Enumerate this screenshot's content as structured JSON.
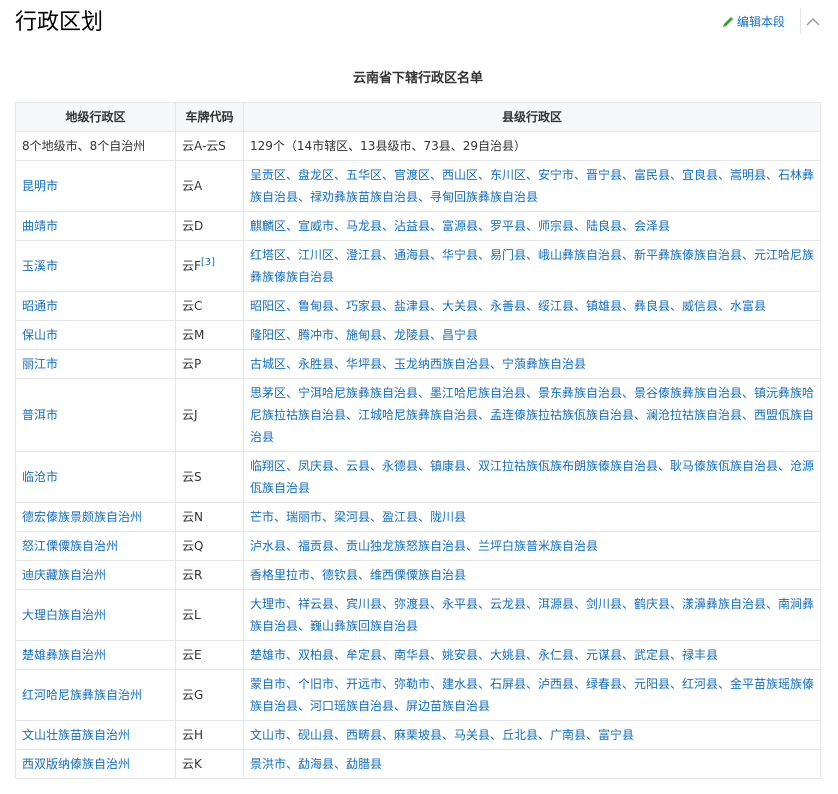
{
  "header": {
    "title": "行政区划",
    "edit_label": "编辑本段"
  },
  "table": {
    "caption": "云南省下辖行政区名单",
    "headers": [
      "地级行政区",
      "车牌代码",
      "县级行政区"
    ],
    "summary": {
      "city": "8个地级市、8个自治州",
      "plate": "云A-云S",
      "counties": "129个（14市辖区、13县级市、73县、29自治县）"
    },
    "rows": [
      {
        "city": "昆明市",
        "plate": "云A",
        "counties": "呈贡区、盘龙区、五华区、官渡区、西山区、东川区、安宁市、晋宁县、富民县、宜良县、嵩明县、石林彝族自治县、禄劝彝族苗族自治县、寻甸回族彝族自治县"
      },
      {
        "city": "曲靖市",
        "plate": "云D",
        "counties": "麒麟区、宣威市、马龙县、沾益县、富源县、罗平县、师宗县、陆良县、会泽县"
      },
      {
        "city": "玉溪市",
        "plate": "云F",
        "plate_ref": "[3]",
        "counties": "红塔区、江川区、澄江县、通海县、华宁县、易门县、峨山彝族自治县、新平彝族傣族自治县、元江哈尼族彝族傣族自治县"
      },
      {
        "city": "昭通市",
        "plate": "云C",
        "counties": "昭阳区、鲁甸县、巧家县、盐津县、大关县、永善县、绥江县、镇雄县、彝良县、威信县、水富县"
      },
      {
        "city": "保山市",
        "plate": "云M",
        "counties": "隆阳区、腾冲市、施甸县、龙陵县、昌宁县"
      },
      {
        "city": "丽江市",
        "plate": "云P",
        "counties": "古城区、永胜县、华坪县、玉龙纳西族自治县、宁蒗彝族自治县"
      },
      {
        "city": "普洱市",
        "plate": "云J",
        "counties": "思茅区、宁洱哈尼族彝族自治县、墨江哈尼族自治县、景东彝族自治县、景谷傣族彝族自治县、镇沅彝族哈尼族拉祜族自治县、江城哈尼族彝族自治县、孟连傣族拉祜族佤族自治县、澜沧拉祜族自治县、西盟佤族自治县"
      },
      {
        "city": "临沧市",
        "plate": "云S",
        "counties": "临翔区、凤庆县、云县、永德县、镇康县、双江拉祜族佤族布朗族傣族自治县、耿马傣族佤族自治县、沧源佤族自治县"
      },
      {
        "city": "德宏傣族景颇族自治州",
        "plate": "云N",
        "counties": "芒市、瑞丽市、梁河县、盈江县、陇川县"
      },
      {
        "city": "怒江傈僳族自治州",
        "plate": "云Q",
        "counties": "泸水县、福贡县、贡山独龙族怒族自治县、兰坪白族普米族自治县"
      },
      {
        "city": "迪庆藏族自治州",
        "plate": "云R",
        "counties": "香格里拉市、德钦县、维西傈僳族自治县"
      },
      {
        "city": "大理白族自治州",
        "plate": "云L",
        "counties": "大理市、祥云县、宾川县、弥渡县、永平县、云龙县、洱源县、剑川县、鹤庆县、漾濞彝族自治县、南涧彝族自治县、巍山彝族回族自治县"
      },
      {
        "city": "楚雄彝族自治州",
        "plate": "云E",
        "counties": "楚雄市、双柏县、牟定县、南华县、姚安县、大姚县、永仁县、元谋县、武定县、禄丰县"
      },
      {
        "city": "红河哈尼族彝族自治州",
        "plate": "云G",
        "counties": "蒙自市、个旧市、开远市、弥勒市、建水县、石屏县、泸西县、绿春县、元阳县、红河县、金平苗族瑶族傣族自治县、河口瑶族自治县、屏边苗族自治县"
      },
      {
        "city": "文山壮族苗族自治州",
        "plate": "云H",
        "counties": "文山市、砚山县、西畴县、麻栗坡县、马关县、丘北县、广南县、富宁县"
      },
      {
        "city": "西双版纳傣族自治州",
        "plate": "云K",
        "counties": "景洪市、勐海县、勐腊县"
      }
    ]
  }
}
